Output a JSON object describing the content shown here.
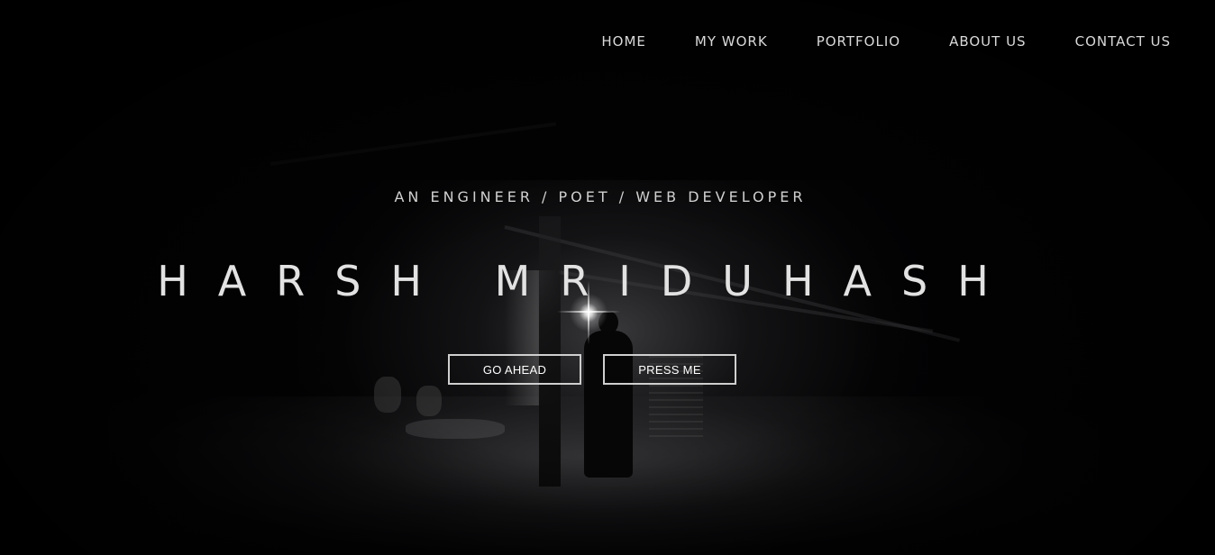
{
  "nav": {
    "items": [
      {
        "label": "HOME"
      },
      {
        "label": "MY WORK"
      },
      {
        "label": "PORTFOLIO"
      },
      {
        "label": "ABOUT US"
      },
      {
        "label": "CONTACT US"
      }
    ]
  },
  "hero": {
    "tagline": "AN ENGINEER / POET / WEB DEVELOPER",
    "name": "HARSH MRIDUHASH",
    "buttons": [
      {
        "label": "GO AHEAD"
      },
      {
        "label": "PRESS ME"
      }
    ]
  },
  "colors": {
    "background": "#000000",
    "text": "#d9d9d9",
    "button_border": "#cfcfcf"
  }
}
